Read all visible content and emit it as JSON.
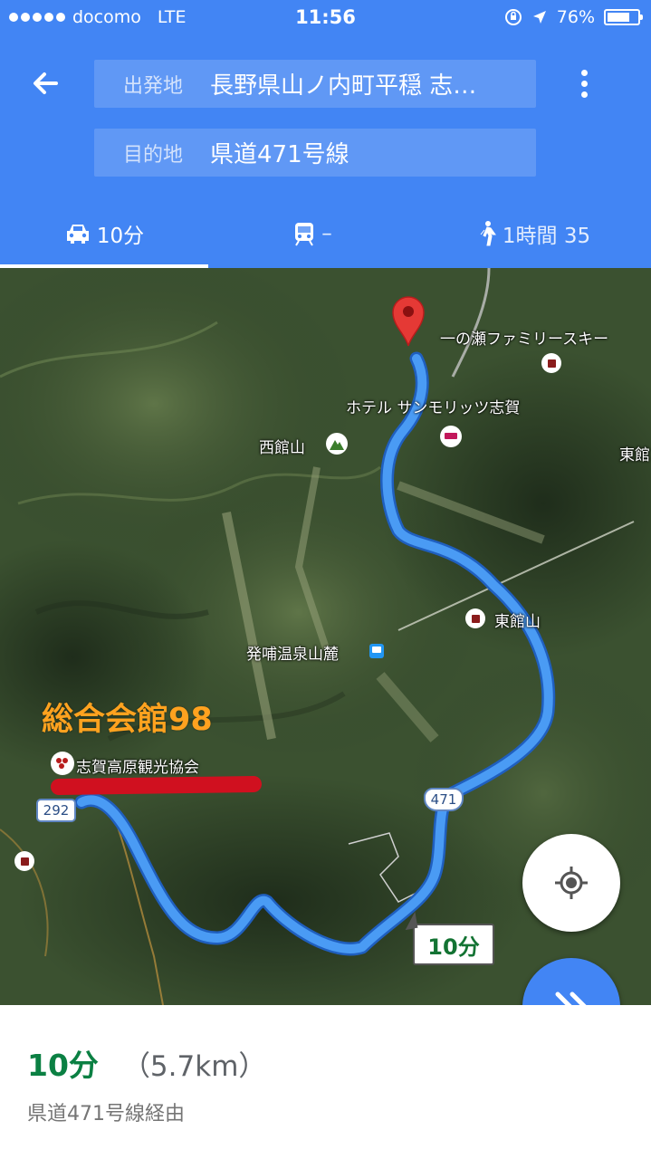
{
  "status_bar": {
    "carrier": "docomo",
    "network": "LTE",
    "time": "11:56",
    "battery": "76%",
    "battery_level": 0.76
  },
  "header": {
    "origin_label": "出発地",
    "origin_value": "長野県山ノ内町平穏 志…",
    "destination_label": "目的地",
    "destination_value": "県道471号線"
  },
  "tabs": [
    {
      "icon": "car-icon",
      "label": "10分",
      "selected": true
    },
    {
      "icon": "train-icon",
      "label": "–",
      "selected": false
    },
    {
      "icon": "walk-icon",
      "label": "1時間 35",
      "selected": false
    }
  ],
  "map": {
    "labels": {
      "ski_area": "一の瀬ファミリースキー",
      "hotel": "ホテル サンモリッツ志賀",
      "nishidateyama": "西館山",
      "higashidate_edge": "東館",
      "higashidateyama": "東館山",
      "onsen": "発哺温泉山麓",
      "tourism_assoc": "志賀高原観光協会"
    },
    "annotation": "総合会館98",
    "road_shields": [
      "292",
      "471"
    ],
    "route_time": "10分",
    "colors": {
      "route": "#4a9bf4",
      "pin": "#e53935",
      "annotation": "#ffa21f",
      "underline_mark": "#d0101f"
    }
  },
  "summary": {
    "duration": "10分",
    "distance": "（5.7km）",
    "via": "県道471号線経由"
  }
}
